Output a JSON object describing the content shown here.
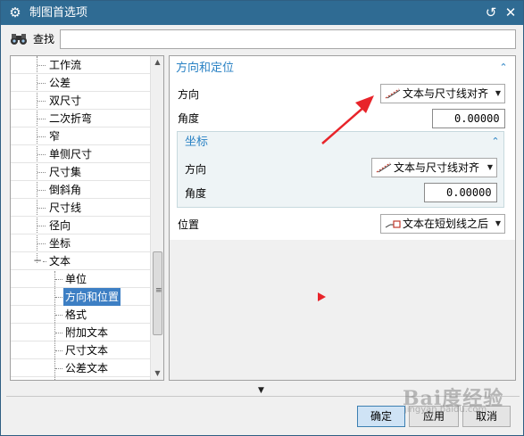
{
  "window": {
    "title": "制图首选项",
    "colors": {
      "titlebar": "#2f6b93",
      "accent": "#2a82c4",
      "selection": "#3d7fc4",
      "annotation": "#e8242a"
    }
  },
  "search": {
    "label": "查找",
    "value": "",
    "icons": [
      "binoculars-icon"
    ]
  },
  "tree": {
    "items": [
      {
        "label": "工作流",
        "level": 1
      },
      {
        "label": "公差",
        "level": 1
      },
      {
        "label": "双尺寸",
        "level": 1
      },
      {
        "label": "二次折弯",
        "level": 1
      },
      {
        "label": "窄",
        "level": 1
      },
      {
        "label": "单侧尺寸",
        "level": 1
      },
      {
        "label": "尺寸集",
        "level": 1
      },
      {
        "label": "倒斜角",
        "level": 1
      },
      {
        "label": "尺寸线",
        "level": 1
      },
      {
        "label": "径向",
        "level": 1
      },
      {
        "label": "坐标",
        "level": 1
      },
      {
        "label": "文本",
        "level": 1,
        "expanded": true
      },
      {
        "label": "单位",
        "level": 2
      },
      {
        "label": "方向和位置",
        "level": 2,
        "selected": true
      },
      {
        "label": "格式",
        "level": 2
      },
      {
        "label": "附加文本",
        "level": 2
      },
      {
        "label": "尺寸文本",
        "level": 2
      },
      {
        "label": "公差文本",
        "level": 2
      }
    ]
  },
  "section": {
    "title": "方向和定位",
    "orientation": {
      "label": "方向",
      "value": "文本与尺寸线对齐"
    },
    "angle": {
      "label": "角度",
      "value": "0.00000"
    },
    "position": {
      "label": "位置",
      "value": "文本在短划线之后"
    }
  },
  "subsection": {
    "title": "坐标",
    "orientation": {
      "label": "方向",
      "value": "文本与尺寸线对齐"
    },
    "angle": {
      "label": "角度",
      "value": "0.00000"
    }
  },
  "buttons": {
    "ok": "确定",
    "apply": "应用",
    "cancel": "取消"
  },
  "watermark": {
    "text": "Bai度经验",
    "sub": "jingyan.baidu.com"
  }
}
